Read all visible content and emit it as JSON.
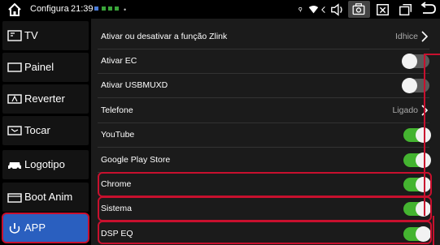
{
  "status_bar": {
    "title": "Configura",
    "time": "21:39",
    "notification_colors": [
      "#4a7bd8",
      "#3aa53a",
      "#3aa53a",
      "#3aa53a"
    ],
    "icons": [
      "home-icon",
      "location-icon",
      "wifi-icon",
      "back-arrows-icon",
      "volume-icon",
      "screenshot-icon",
      "close-window-icon",
      "recent-apps-icon",
      "return-icon"
    ]
  },
  "sidebar": {
    "items": [
      {
        "label": "TV",
        "icon": "tv-icon"
      },
      {
        "label": "Painel",
        "icon": "panel-icon"
      },
      {
        "label": "Reverter",
        "icon": "reverse-camera-icon"
      },
      {
        "label": "Tocar",
        "icon": "touch-icon"
      },
      {
        "label": "Logotipo",
        "icon": "car-logo-icon"
      },
      {
        "label": "Boot Anim",
        "icon": "boot-anim-icon"
      },
      {
        "label": "APP",
        "icon": "app-icon",
        "active": true
      }
    ]
  },
  "settings": {
    "rows": [
      {
        "label": "Ativar ou desativar a função Zlink",
        "value": "Idhice",
        "type": "link"
      },
      {
        "label": "Ativar EC",
        "type": "toggle",
        "on": false
      },
      {
        "label": "Ativar USBMUXD",
        "type": "toggle",
        "on": false
      },
      {
        "label": "Telefone",
        "value": "Ligado",
        "type": "link"
      },
      {
        "label": "YouTube",
        "type": "toggle",
        "on": true
      },
      {
        "label": "Google Play Store",
        "type": "toggle",
        "on": true
      },
      {
        "label": "Chrome",
        "type": "toggle",
        "on": true,
        "highlighted": true
      },
      {
        "label": "Sistema",
        "type": "toggle",
        "on": true,
        "highlighted": true
      },
      {
        "label": "DSP EQ",
        "type": "toggle",
        "on": true,
        "highlighted": true
      }
    ]
  },
  "colors": {
    "accent_blue": "#2a5fbf",
    "toggle_on": "#44b430",
    "highlight_red": "#c8102e"
  }
}
